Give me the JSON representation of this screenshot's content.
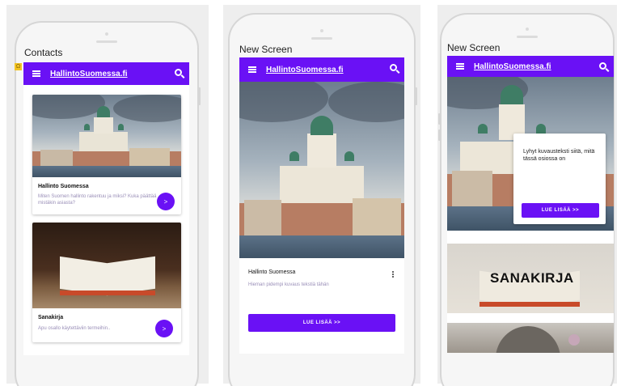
{
  "screens": [
    {
      "label": "Contacts",
      "appbar_title": "HallintoSuomessa.fi",
      "cards": [
        {
          "title": "Hallinto Suomessa",
          "subtitle": "Miten Suomen hallinto rakentuu ja miksi? Kuka päättää mistäkin asiasta?",
          "fab_label": ">"
        },
        {
          "title": "Sanakirja",
          "subtitle": "Apu osallo käytettäviin termeihin..",
          "fab_label": ">"
        }
      ]
    },
    {
      "label": "New Screen",
      "appbar_title": "HallintoSuomessa.fi",
      "card_title": "Hallinto Suomessa",
      "card_subtitle": "Hieman pidempi kuvaus tekstiä tähän",
      "button_label": "LUE LISÄÄ >>"
    },
    {
      "label": "New Screen",
      "appbar_title": "HallintoSuomessa.fi",
      "overlay_text": "Lyhyt kuvausteksti siitä, mitä tässä osiossa on",
      "button_label": "LUE LISÄÄ >>",
      "banner_word": "SANAKIRJA"
    }
  ],
  "badge_glyph": "Ω",
  "colors": {
    "primary": "#6a11f5",
    "panel_bg": "#eeeeee",
    "subtitle": "#9a8fb8"
  }
}
